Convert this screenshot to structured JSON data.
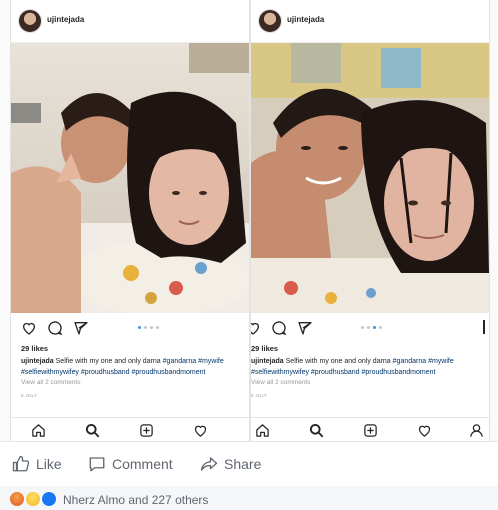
{
  "post": {
    "username": "ujintejada",
    "likes": "29 likes",
    "caption_user": "ujintejada",
    "caption_text": "Selfie with my one and only darna",
    "caption_tags_line1": "#gandarna #mywife",
    "caption_tags_line2": "#selfiewithmywifey #proudhusband #proudhusbandmoment",
    "view_comments": "View all 2 comments",
    "date": "5 JULY"
  },
  "panels": [
    {
      "name": "left",
      "carousel_active": 0,
      "carousel_count": 4
    },
    {
      "name": "right",
      "carousel_active": 2,
      "carousel_count": 4
    }
  ],
  "icons": {
    "action": [
      "heart-icon",
      "comment-icon",
      "share-icon"
    ],
    "nav": [
      "home-icon",
      "search-icon",
      "add-post-icon",
      "activity-icon",
      "profile-icon"
    ]
  },
  "facebook": {
    "like_label": "Like",
    "comment_label": "Comment",
    "share_label": "Share",
    "reactions": [
      "angry",
      "sad",
      "like"
    ],
    "reaction_summary": "Nherz Almo and 227 others"
  },
  "colors": {
    "ig_link": "#003569",
    "carousel_active": "#3897f0",
    "fb_text": "#606770"
  }
}
